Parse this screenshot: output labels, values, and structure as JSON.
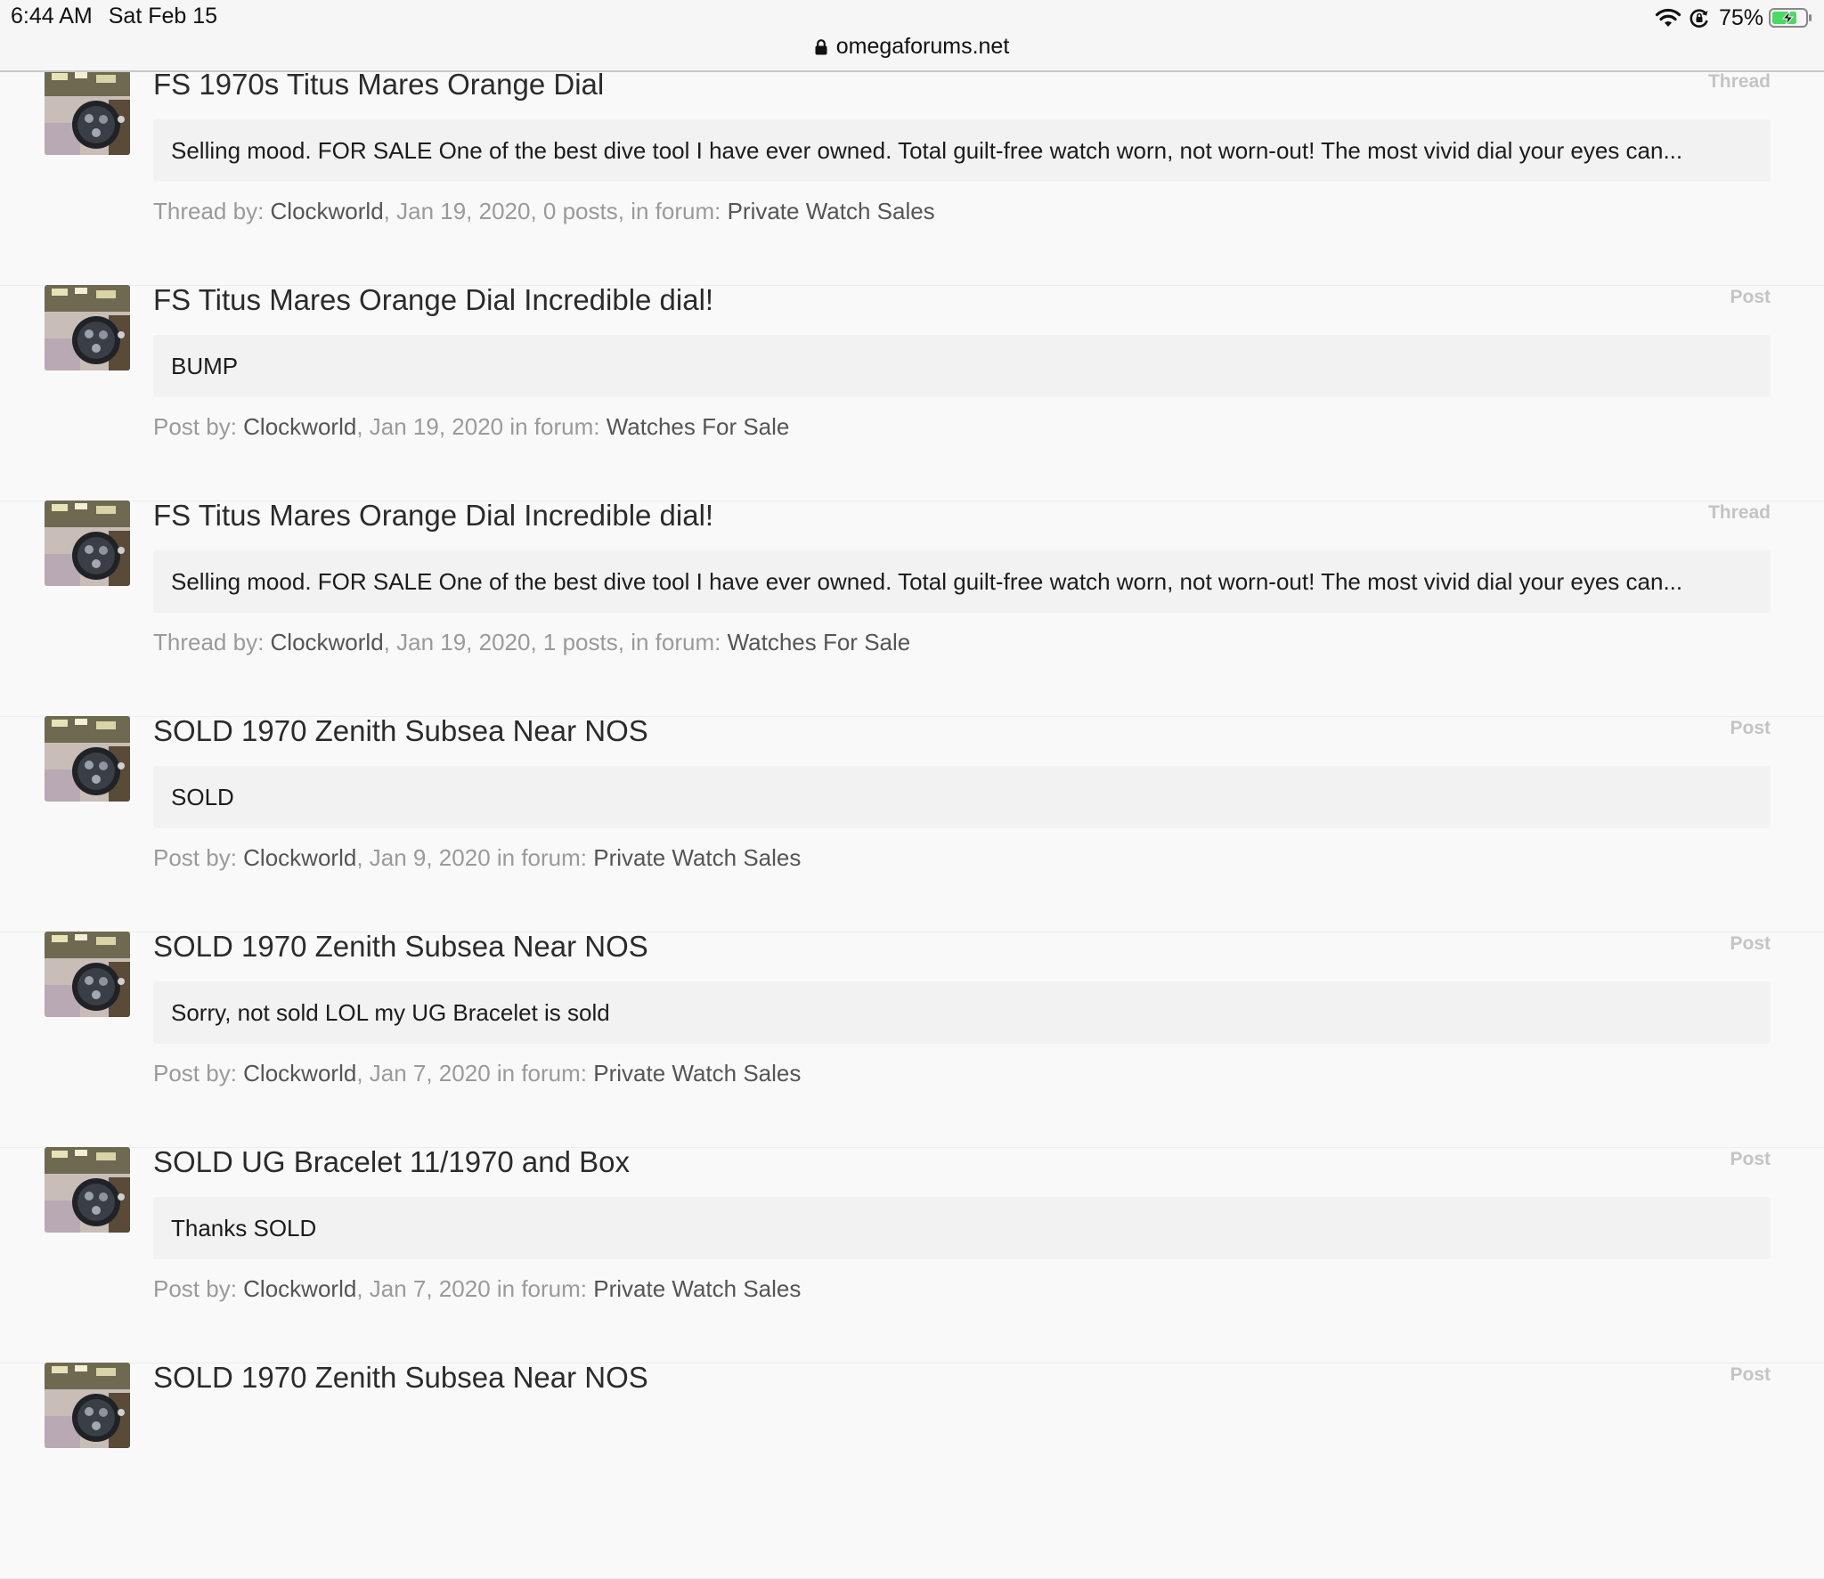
{
  "status_bar": {
    "time": "6:44 AM",
    "date": "Sat Feb 15",
    "battery_percent": "75%",
    "battery_level": 0.75,
    "charging": true,
    "url": "omegaforums.net"
  },
  "results": [
    {
      "title": "FS 1970s Titus Mares Orange Dial",
      "type": "Thread",
      "snippet": "Selling mood. FOR SALE One of the best dive tool I have ever owned. Total guilt-free watch worn, not worn-out! The most vivid dial your eyes can...",
      "meta_prefix": "Thread by: ",
      "author": "Clockworld",
      "meta_middle": ", Jan 19, 2020, 0 posts, in forum: ",
      "forum": "Private Watch Sales"
    },
    {
      "title": "FS Titus Mares Orange Dial Incredible dial!",
      "type": "Post",
      "snippet": "BUMP",
      "meta_prefix": "Post by: ",
      "author": "Clockworld",
      "meta_middle": ", Jan 19, 2020 in forum: ",
      "forum": "Watches For Sale"
    },
    {
      "title": "FS Titus Mares Orange Dial Incredible dial!",
      "type": "Thread",
      "snippet": "Selling mood. FOR SALE One of the best dive tool I have ever owned. Total guilt-free watch worn, not worn-out! The most vivid dial your eyes can...",
      "meta_prefix": "Thread by: ",
      "author": "Clockworld",
      "meta_middle": ", Jan 19, 2020, 1 posts, in forum: ",
      "forum": "Watches For Sale"
    },
    {
      "title": "SOLD 1970 Zenith Subsea Near NOS",
      "type": "Post",
      "snippet": "SOLD",
      "meta_prefix": "Post by: ",
      "author": "Clockworld",
      "meta_middle": ", Jan 9, 2020 in forum: ",
      "forum": "Private Watch Sales"
    },
    {
      "title": "SOLD 1970 Zenith Subsea Near NOS",
      "type": "Post",
      "snippet": "Sorry, not sold LOL my UG Bracelet is sold",
      "meta_prefix": "Post by: ",
      "author": "Clockworld",
      "meta_middle": ", Jan 7, 2020 in forum: ",
      "forum": "Private Watch Sales"
    },
    {
      "title": "SOLD UG Bracelet 11/1970 and Box",
      "type": "Post",
      "snippet": "Thanks SOLD",
      "meta_prefix": "Post by: ",
      "author": "Clockworld",
      "meta_middle": ", Jan 7, 2020 in forum: ",
      "forum": "Private Watch Sales"
    },
    {
      "title": "SOLD 1970 Zenith Subsea Near NOS",
      "type": "Post",
      "snippet": "",
      "meta_prefix": "",
      "author": "",
      "meta_middle": "",
      "forum": ""
    }
  ]
}
